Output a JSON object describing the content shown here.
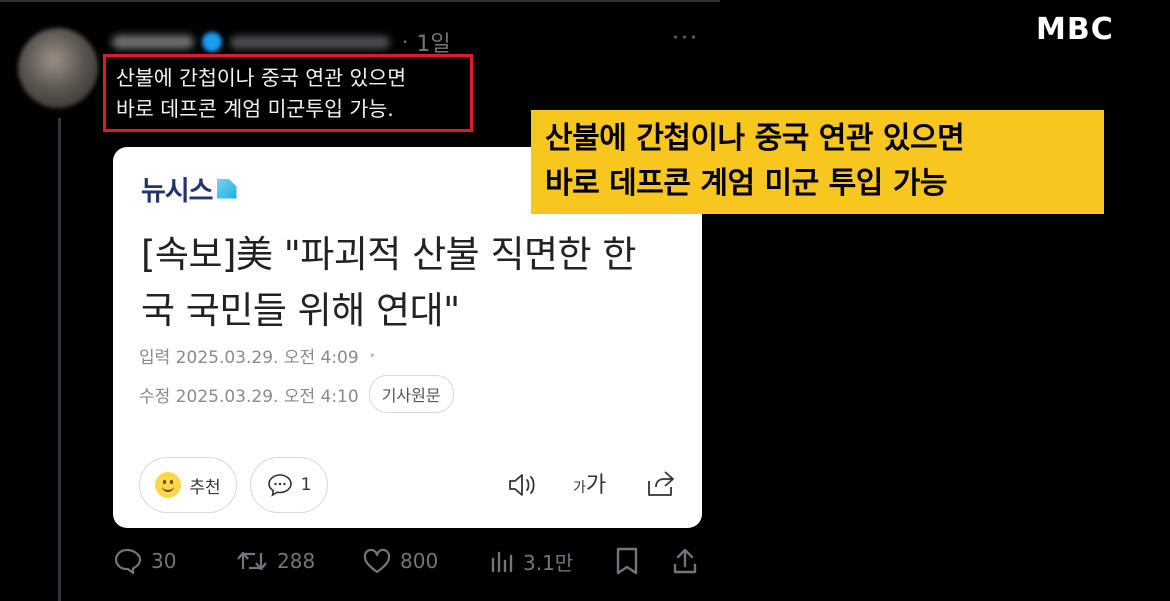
{
  "watermark": {
    "logo": "MBC"
  },
  "post": {
    "time": "1일",
    "dot": "·",
    "more": "···",
    "text_lines": [
      "산불에 간첩이나 중국 연관 있으면",
      "바로 데프콘 계엄 미군투입 가능."
    ]
  },
  "card": {
    "logo_text": "뉴시스",
    "headline_lines": [
      "[속보]美 \"파괴적 산불 직면한 한",
      "국 국민들 위해 연대\""
    ],
    "input_time": "입력 2025.03.29. 오전 4:09",
    "edit_time": "수정 2025.03.29. 오전 4:10",
    "original_button": "기사원문",
    "like_label": "추천",
    "comment_count": "1",
    "font_small": "가",
    "font_big": "가"
  },
  "caption": {
    "lines": [
      "산불에 간첩이나 중국 연관 있으면",
      "바로 데프콘 계엄 미군 투입 가능"
    ]
  },
  "stats": {
    "replies": "30",
    "reposts": "288",
    "likes": "800",
    "views": "3.1만"
  },
  "colors": {
    "highlight_border": "#e01b22",
    "caption_bg": "#f7c61f",
    "stat_gray": "#71767b"
  }
}
